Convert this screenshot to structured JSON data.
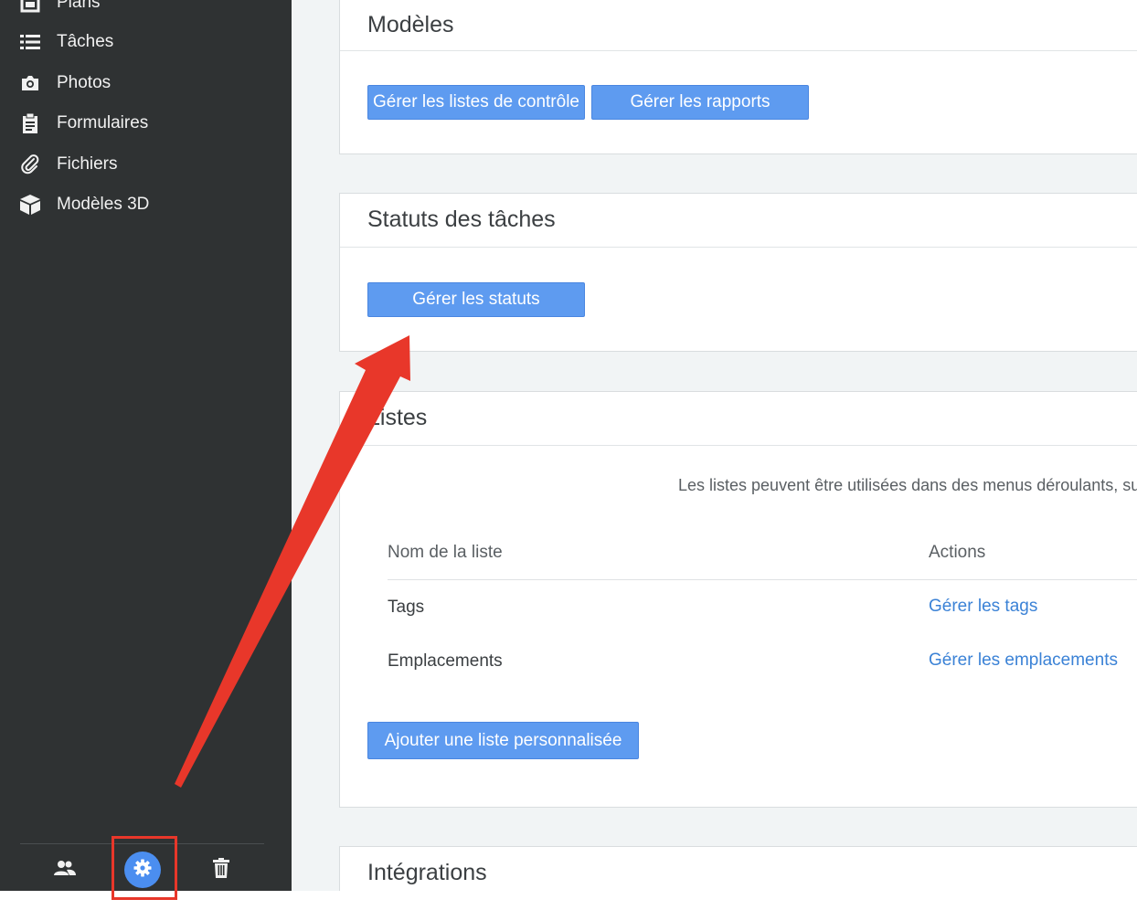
{
  "sidebar": {
    "items": [
      {
        "label": "Plans",
        "icon": "plans-icon"
      },
      {
        "label": "Tâches",
        "icon": "list-icon"
      },
      {
        "label": "Photos",
        "icon": "camera-icon"
      },
      {
        "label": "Formulaires",
        "icon": "clipboard-icon"
      },
      {
        "label": "Fichiers",
        "icon": "paperclip-icon"
      },
      {
        "label": "Modèles 3D",
        "icon": "cube-icon"
      }
    ],
    "bottom": [
      {
        "icon": "users-icon"
      },
      {
        "icon": "gear-icon",
        "active": true
      },
      {
        "icon": "trash-icon"
      }
    ]
  },
  "modeles": {
    "title": "Modèles",
    "btn_checklists": "Gérer les listes de contrôle",
    "btn_reports": "Gérer les rapports"
  },
  "statuts": {
    "title": "Statuts des tâches",
    "btn_manage": "Gérer les statuts"
  },
  "listes": {
    "title": "Listes",
    "description": "Les listes peuvent être utilisées dans des menus déroulants, su",
    "col_name": "Nom de la liste",
    "col_actions": "Actions",
    "rows": [
      {
        "name": "Tags",
        "action": "Gérer les tags"
      },
      {
        "name": "Emplacements",
        "action": "Gérer les emplacements"
      }
    ],
    "btn_add": "Ajouter une liste personnalisée"
  },
  "integrations": {
    "title": "Intégrations"
  },
  "colors": {
    "sidebar_bg": "#2f3233",
    "accent": "#5e9bf0",
    "link": "#3b82d6",
    "annotation": "#e8372a"
  }
}
